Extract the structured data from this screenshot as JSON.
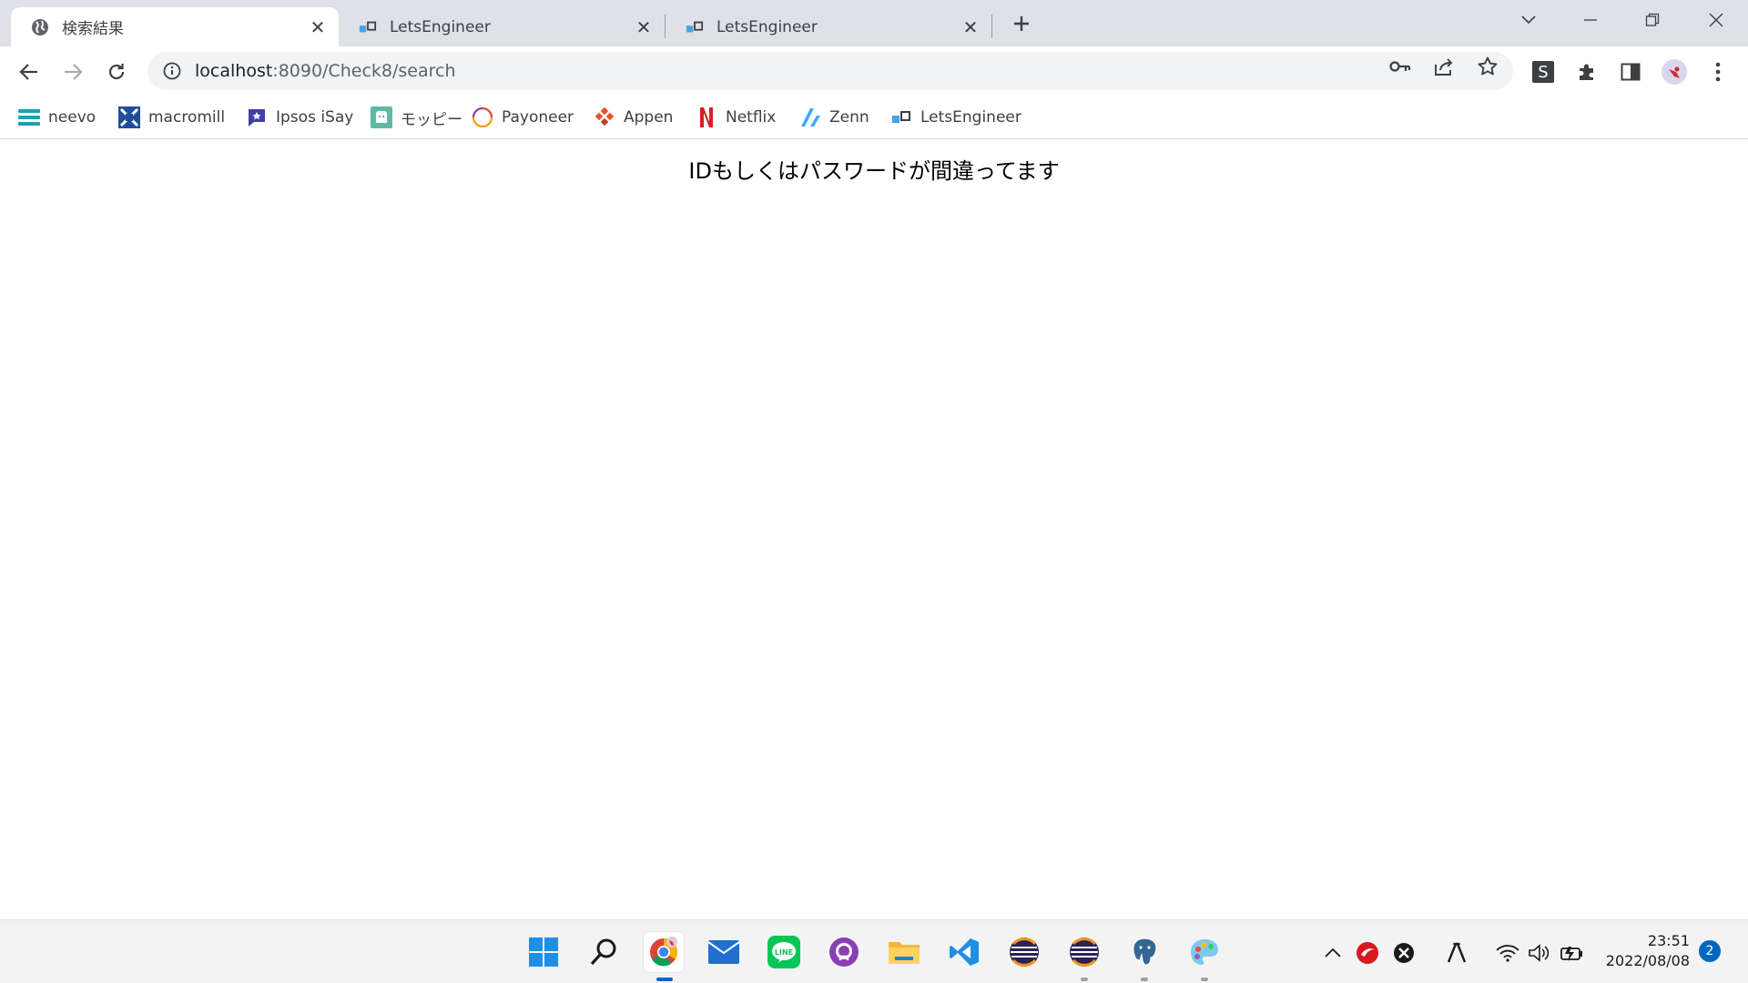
{
  "tabs": [
    {
      "title": "検索結果",
      "active": true,
      "icon": "globe-icon"
    },
    {
      "title": "LetsEngineer",
      "active": false,
      "icon": "letsengineer-icon"
    },
    {
      "title": "LetsEngineer",
      "active": false,
      "icon": "letsengineer-icon"
    }
  ],
  "address_bar": {
    "host": "localhost",
    "path": ":8090/Check8/search"
  },
  "extension_badge": "S",
  "bookmarks": [
    {
      "label": "neevo",
      "icon": "neevo-icon"
    },
    {
      "label": "macromill",
      "icon": "macromill-icon"
    },
    {
      "label": "Ipsos iSay",
      "icon": "ipsos-icon"
    },
    {
      "label": "モッピー",
      "icon": "moppy-icon"
    },
    {
      "label": "Payoneer",
      "icon": "payoneer-icon"
    },
    {
      "label": "Appen",
      "icon": "appen-icon"
    },
    {
      "label": "Netflix",
      "icon": "netflix-icon"
    },
    {
      "label": "Zenn",
      "icon": "zenn-icon"
    },
    {
      "label": "LetsEngineer",
      "icon": "letsengineer-icon"
    }
  ],
  "page": {
    "message": "IDもしくはパスワードが間違ってます"
  },
  "taskbar": {
    "apps": [
      "start",
      "search",
      "chrome",
      "mail",
      "line",
      "github",
      "explorer",
      "vscode",
      "eclipse",
      "eclipse",
      "postgres",
      "paint"
    ],
    "time": "23:51",
    "date": "2022/08/08",
    "notifications": "2",
    "ime": "A"
  },
  "colors": {
    "tabstrip": "#dee1e6",
    "accent": "#0067c0"
  }
}
